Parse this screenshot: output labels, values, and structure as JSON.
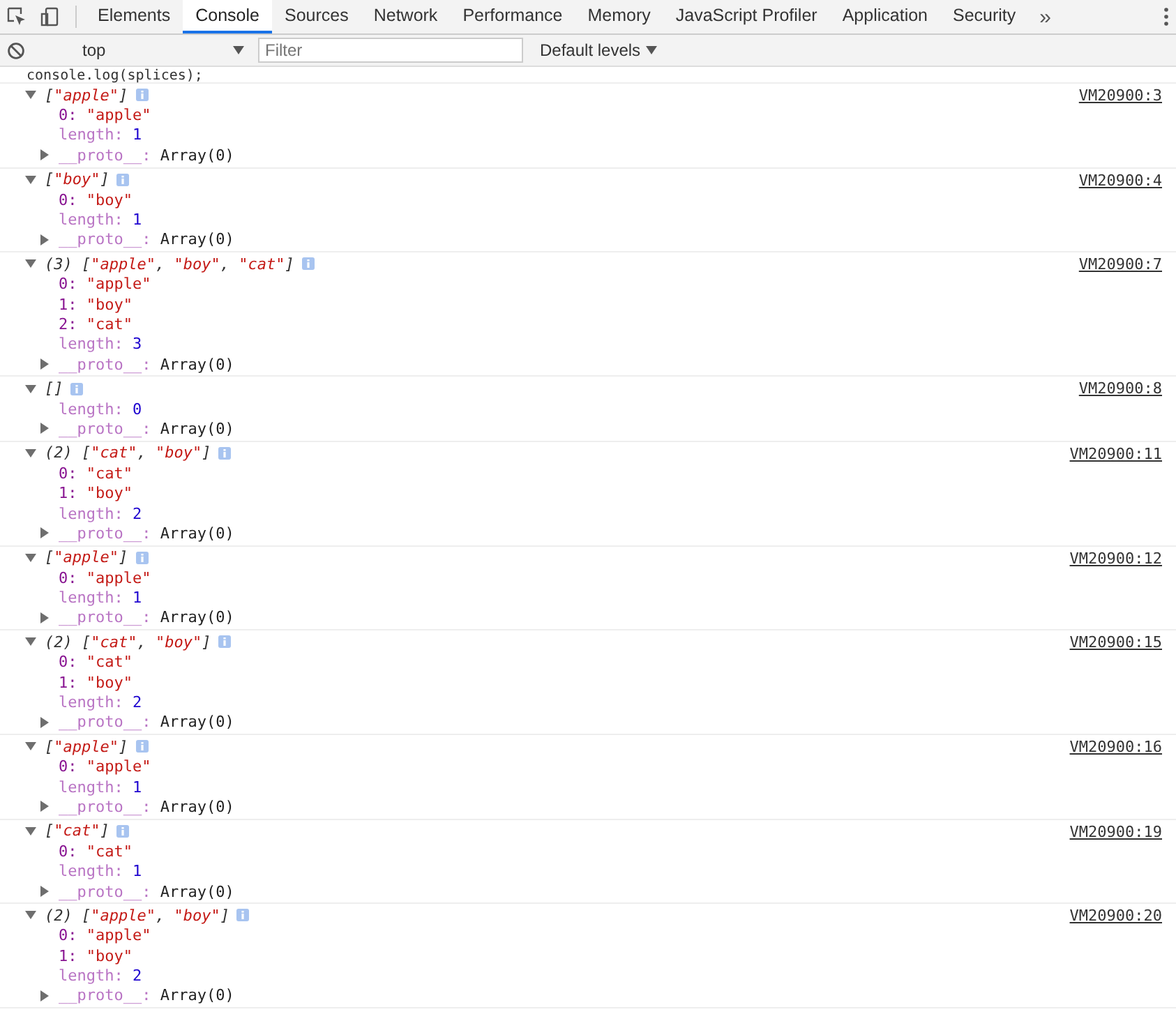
{
  "tabs": [
    {
      "label": "Elements",
      "selected": false
    },
    {
      "label": "Console",
      "selected": true
    },
    {
      "label": "Sources",
      "selected": false
    },
    {
      "label": "Network",
      "selected": false
    },
    {
      "label": "Performance",
      "selected": false
    },
    {
      "label": "Memory",
      "selected": false
    },
    {
      "label": "JavaScript Profiler",
      "selected": false
    },
    {
      "label": "Application",
      "selected": false
    },
    {
      "label": "Security",
      "selected": false
    }
  ],
  "more_tabs": "»",
  "toolbar": {
    "context": "top",
    "filter": {
      "placeholder": "Filter"
    },
    "levels": "Default levels"
  },
  "command": "console.log(splices);",
  "entries": [
    {
      "expanded": true,
      "source": "VM20900:3",
      "preview": [
        {
          "kind": "punct",
          "text": "["
        },
        {
          "kind": "string",
          "text": "\"apple\""
        },
        {
          "kind": "punct",
          "text": "]"
        }
      ],
      "props": [
        {
          "kind": "index",
          "key": "0:",
          "value": "\"apple\""
        },
        {
          "kind": "length",
          "key": "length:",
          "value": "1"
        },
        {
          "kind": "proto",
          "key": "__proto__:",
          "value": "Array(0)",
          "expanded": false
        }
      ]
    },
    {
      "expanded": true,
      "source": "VM20900:4",
      "preview": [
        {
          "kind": "punct",
          "text": "["
        },
        {
          "kind": "string",
          "text": "\"boy\""
        },
        {
          "kind": "punct",
          "text": "]"
        }
      ],
      "props": [
        {
          "kind": "index",
          "key": "0:",
          "value": "\"boy\""
        },
        {
          "kind": "length",
          "key": "length:",
          "value": "1"
        },
        {
          "kind": "proto",
          "key": "__proto__:",
          "value": "Array(0)",
          "expanded": false
        }
      ]
    },
    {
      "expanded": true,
      "source": "VM20900:7",
      "count": "(3)",
      "preview": [
        {
          "kind": "punct",
          "text": "["
        },
        {
          "kind": "string",
          "text": "\"apple\""
        },
        {
          "kind": "punct",
          "text": ", "
        },
        {
          "kind": "string",
          "text": "\"boy\""
        },
        {
          "kind": "punct",
          "text": ", "
        },
        {
          "kind": "string",
          "text": "\"cat\""
        },
        {
          "kind": "punct",
          "text": "]"
        }
      ],
      "props": [
        {
          "kind": "index",
          "key": "0:",
          "value": "\"apple\""
        },
        {
          "kind": "index",
          "key": "1:",
          "value": "\"boy\""
        },
        {
          "kind": "index",
          "key": "2:",
          "value": "\"cat\""
        },
        {
          "kind": "length",
          "key": "length:",
          "value": "3"
        },
        {
          "kind": "proto",
          "key": "__proto__:",
          "value": "Array(0)",
          "expanded": false
        }
      ]
    },
    {
      "expanded": true,
      "source": "VM20900:8",
      "preview": [
        {
          "kind": "punct",
          "text": "[]"
        }
      ],
      "props": [
        {
          "kind": "length",
          "key": "length:",
          "value": "0"
        },
        {
          "kind": "proto",
          "key": "__proto__:",
          "value": "Array(0)",
          "expanded": false
        }
      ]
    },
    {
      "expanded": true,
      "source": "VM20900:11",
      "count": "(2)",
      "preview": [
        {
          "kind": "punct",
          "text": "["
        },
        {
          "kind": "string",
          "text": "\"cat\""
        },
        {
          "kind": "punct",
          "text": ", "
        },
        {
          "kind": "string",
          "text": "\"boy\""
        },
        {
          "kind": "punct",
          "text": "]"
        }
      ],
      "props": [
        {
          "kind": "index",
          "key": "0:",
          "value": "\"cat\""
        },
        {
          "kind": "index",
          "key": "1:",
          "value": "\"boy\""
        },
        {
          "kind": "length",
          "key": "length:",
          "value": "2"
        },
        {
          "kind": "proto",
          "key": "__proto__:",
          "value": "Array(0)",
          "expanded": false
        }
      ]
    },
    {
      "expanded": true,
      "source": "VM20900:12",
      "preview": [
        {
          "kind": "punct",
          "text": "["
        },
        {
          "kind": "string",
          "text": "\"apple\""
        },
        {
          "kind": "punct",
          "text": "]"
        }
      ],
      "props": [
        {
          "kind": "index",
          "key": "0:",
          "value": "\"apple\""
        },
        {
          "kind": "length",
          "key": "length:",
          "value": "1"
        },
        {
          "kind": "proto",
          "key": "__proto__:",
          "value": "Array(0)",
          "expanded": false
        }
      ]
    },
    {
      "expanded": true,
      "source": "VM20900:15",
      "count": "(2)",
      "preview": [
        {
          "kind": "punct",
          "text": "["
        },
        {
          "kind": "string",
          "text": "\"cat\""
        },
        {
          "kind": "punct",
          "text": ", "
        },
        {
          "kind": "string",
          "text": "\"boy\""
        },
        {
          "kind": "punct",
          "text": "]"
        }
      ],
      "props": [
        {
          "kind": "index",
          "key": "0:",
          "value": "\"cat\""
        },
        {
          "kind": "index",
          "key": "1:",
          "value": "\"boy\""
        },
        {
          "kind": "length",
          "key": "length:",
          "value": "2"
        },
        {
          "kind": "proto",
          "key": "__proto__:",
          "value": "Array(0)",
          "expanded": false
        }
      ]
    },
    {
      "expanded": true,
      "source": "VM20900:16",
      "preview": [
        {
          "kind": "punct",
          "text": "["
        },
        {
          "kind": "string",
          "text": "\"apple\""
        },
        {
          "kind": "punct",
          "text": "]"
        }
      ],
      "props": [
        {
          "kind": "index",
          "key": "0:",
          "value": "\"apple\""
        },
        {
          "kind": "length",
          "key": "length:",
          "value": "1"
        },
        {
          "kind": "proto",
          "key": "__proto__:",
          "value": "Array(0)",
          "expanded": false
        }
      ]
    },
    {
      "expanded": true,
      "source": "VM20900:19",
      "preview": [
        {
          "kind": "punct",
          "text": "["
        },
        {
          "kind": "string",
          "text": "\"cat\""
        },
        {
          "kind": "punct",
          "text": "]"
        }
      ],
      "props": [
        {
          "kind": "index",
          "key": "0:",
          "value": "\"cat\""
        },
        {
          "kind": "length",
          "key": "length:",
          "value": "1"
        },
        {
          "kind": "proto",
          "key": "__proto__:",
          "value": "Array(0)",
          "expanded": false
        }
      ]
    },
    {
      "expanded": true,
      "source": "VM20900:20",
      "count": "(2)",
      "preview": [
        {
          "kind": "punct",
          "text": "["
        },
        {
          "kind": "string",
          "text": "\"apple\""
        },
        {
          "kind": "punct",
          "text": ", "
        },
        {
          "kind": "string",
          "text": "\"boy\""
        },
        {
          "kind": "punct",
          "text": "]"
        }
      ],
      "props": [
        {
          "kind": "index",
          "key": "0:",
          "value": "\"apple\""
        },
        {
          "kind": "index",
          "key": "1:",
          "value": "\"boy\""
        },
        {
          "kind": "length",
          "key": "length:",
          "value": "2"
        },
        {
          "kind": "proto",
          "key": "__proto__:",
          "value": "Array(0)",
          "expanded": false
        }
      ]
    }
  ]
}
